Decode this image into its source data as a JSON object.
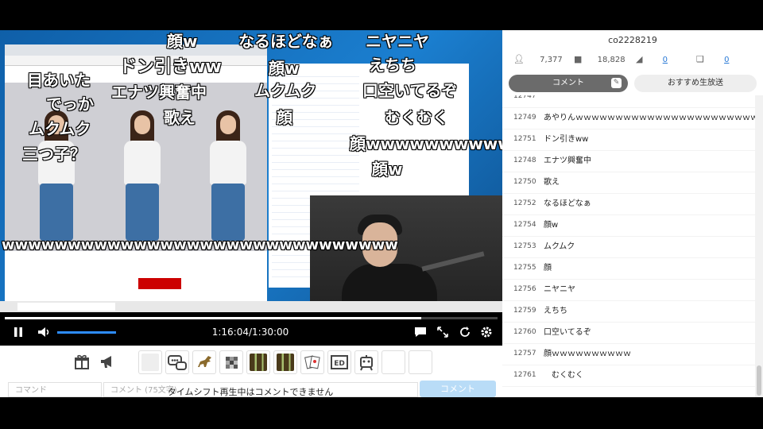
{
  "program": {
    "id": "co2228219",
    "stats": [
      {
        "icon": "viewers-icon",
        "value": "7,377"
      },
      {
        "icon": "comments-icon",
        "value": "18,828"
      },
      {
        "icon": "ad-icon",
        "value": "0"
      },
      {
        "icon": "gift-icon",
        "value": "0"
      }
    ]
  },
  "tabs": {
    "comments": "コメント",
    "recommended": "おすすめ生放送"
  },
  "comments": [
    {
      "no": "12749",
      "text": "あやりんｗｗｗｗｗｗｗｗｗｗｗｗｗｗｗｗｗｗｗｗｗｗｗｗｗｗｗｗｗｗ"
    },
    {
      "no": "12751",
      "text": "ドン引きww"
    },
    {
      "no": "12748",
      "text": "エナツ興奮中"
    },
    {
      "no": "12750",
      "text": "歌え"
    },
    {
      "no": "12752",
      "text": "なるほどなぁ"
    },
    {
      "no": "12754",
      "text": "顔w"
    },
    {
      "no": "12753",
      "text": "ムクムク"
    },
    {
      "no": "12755",
      "text": "顔"
    },
    {
      "no": "12756",
      "text": "ニヤニヤ"
    },
    {
      "no": "12759",
      "text": "えちち"
    },
    {
      "no": "12760",
      "text": "口空いてるぞ"
    },
    {
      "no": "12757",
      "text": "顔ｗｗｗｗｗｗｗｗｗｗ"
    },
    {
      "no": "12761",
      "text": "　むくむく"
    }
  ],
  "danmaku": [
    {
      "text": "顔w",
      "size": "d20"
    },
    {
      "text": "なるほどなぁ",
      "size": "d20"
    },
    {
      "text": "ニヤニヤ",
      "size": "d20"
    },
    {
      "text": "目あいた",
      "size": "d20"
    },
    {
      "text": "ドン引きww",
      "size": "d22"
    },
    {
      "text": "顔w",
      "size": "d20"
    },
    {
      "text": "えちち",
      "size": "d20"
    },
    {
      "text": "でっか",
      "size": "d20"
    },
    {
      "text": "エナツ興奮中",
      "size": "d20"
    },
    {
      "text": "ムクムク",
      "size": "d20"
    },
    {
      "text": "口空いてるぞ",
      "size": "d20"
    },
    {
      "text": "ムクムク",
      "size": "d20"
    },
    {
      "text": "歌え",
      "size": "d20"
    },
    {
      "text": "顔",
      "size": "d20"
    },
    {
      "text": "むくむく",
      "size": "d20"
    },
    {
      "text": "三つ子？",
      "size": "d20"
    },
    {
      "text": "顔wwwwwwwwwwww",
      "size": "d20"
    },
    {
      "text": "顔w",
      "size": "d20"
    },
    {
      "text": "wwwwwwwwwwwwwwwwwwwwwwwwwwwwww",
      "size": "d20"
    }
  ],
  "player": {
    "time": "1:16:04/1:30:00",
    "progress": 0.845,
    "volume": 0.6
  },
  "comment_form": {
    "command_placeholder": "コマンド",
    "input_placeholder": "コメント (75文字)",
    "send_label": "コメント",
    "notice": "タイムシフト再生中はコメントできません"
  },
  "colors": {
    "accent": "#2d8cff",
    "tab_active": "#6b6b6b",
    "send_disabled": "#b9dcf7"
  }
}
